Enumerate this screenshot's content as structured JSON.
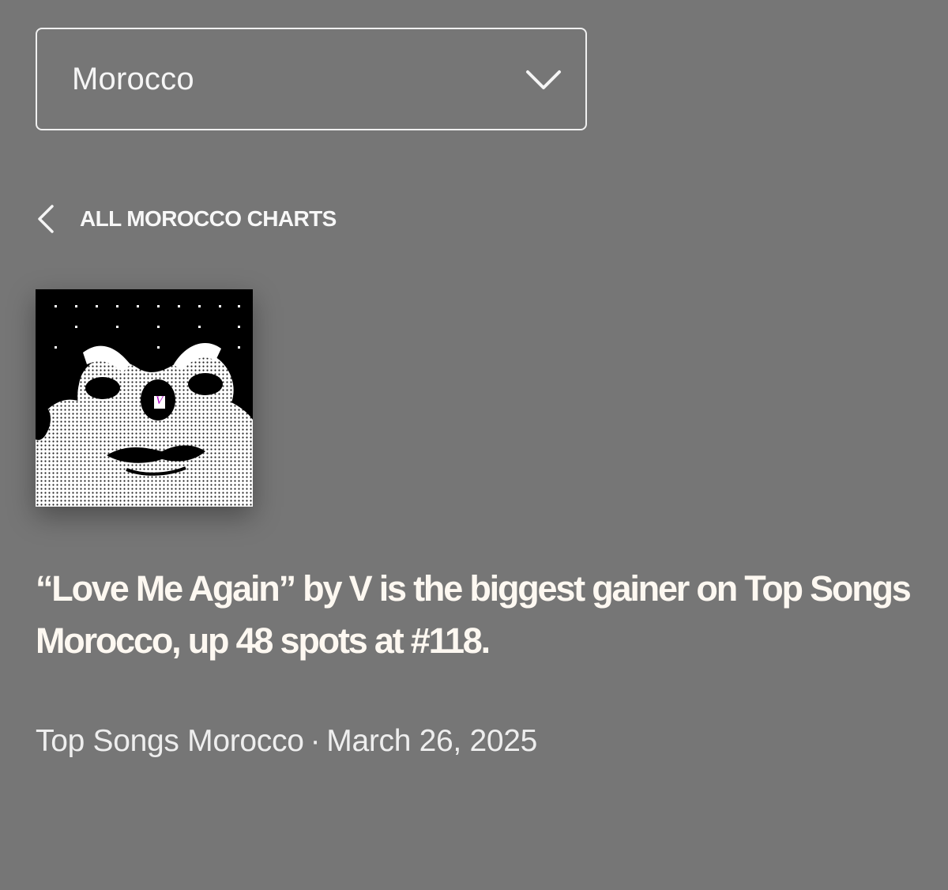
{
  "country_select": {
    "value": "Morocco",
    "icon": "chevron-down-icon"
  },
  "breadcrumb": {
    "icon": "chevron-left-icon",
    "label": "ALL MOROCCO CHARTS"
  },
  "artwork": {
    "description_icon": "album-artwork",
    "overlay_letter": "V",
    "overlay_color": "#b000c8"
  },
  "headline": "“Love Me Again” by V is the biggest gainer on Top Songs Morocco, up 48 spots at #118.",
  "meta": {
    "chart": "Top Songs Morocco",
    "separator": "·",
    "date": "March 26, 2025"
  },
  "colors": {
    "background": "#767676",
    "text": "#ffffff",
    "headline": "#fdf8f1"
  }
}
